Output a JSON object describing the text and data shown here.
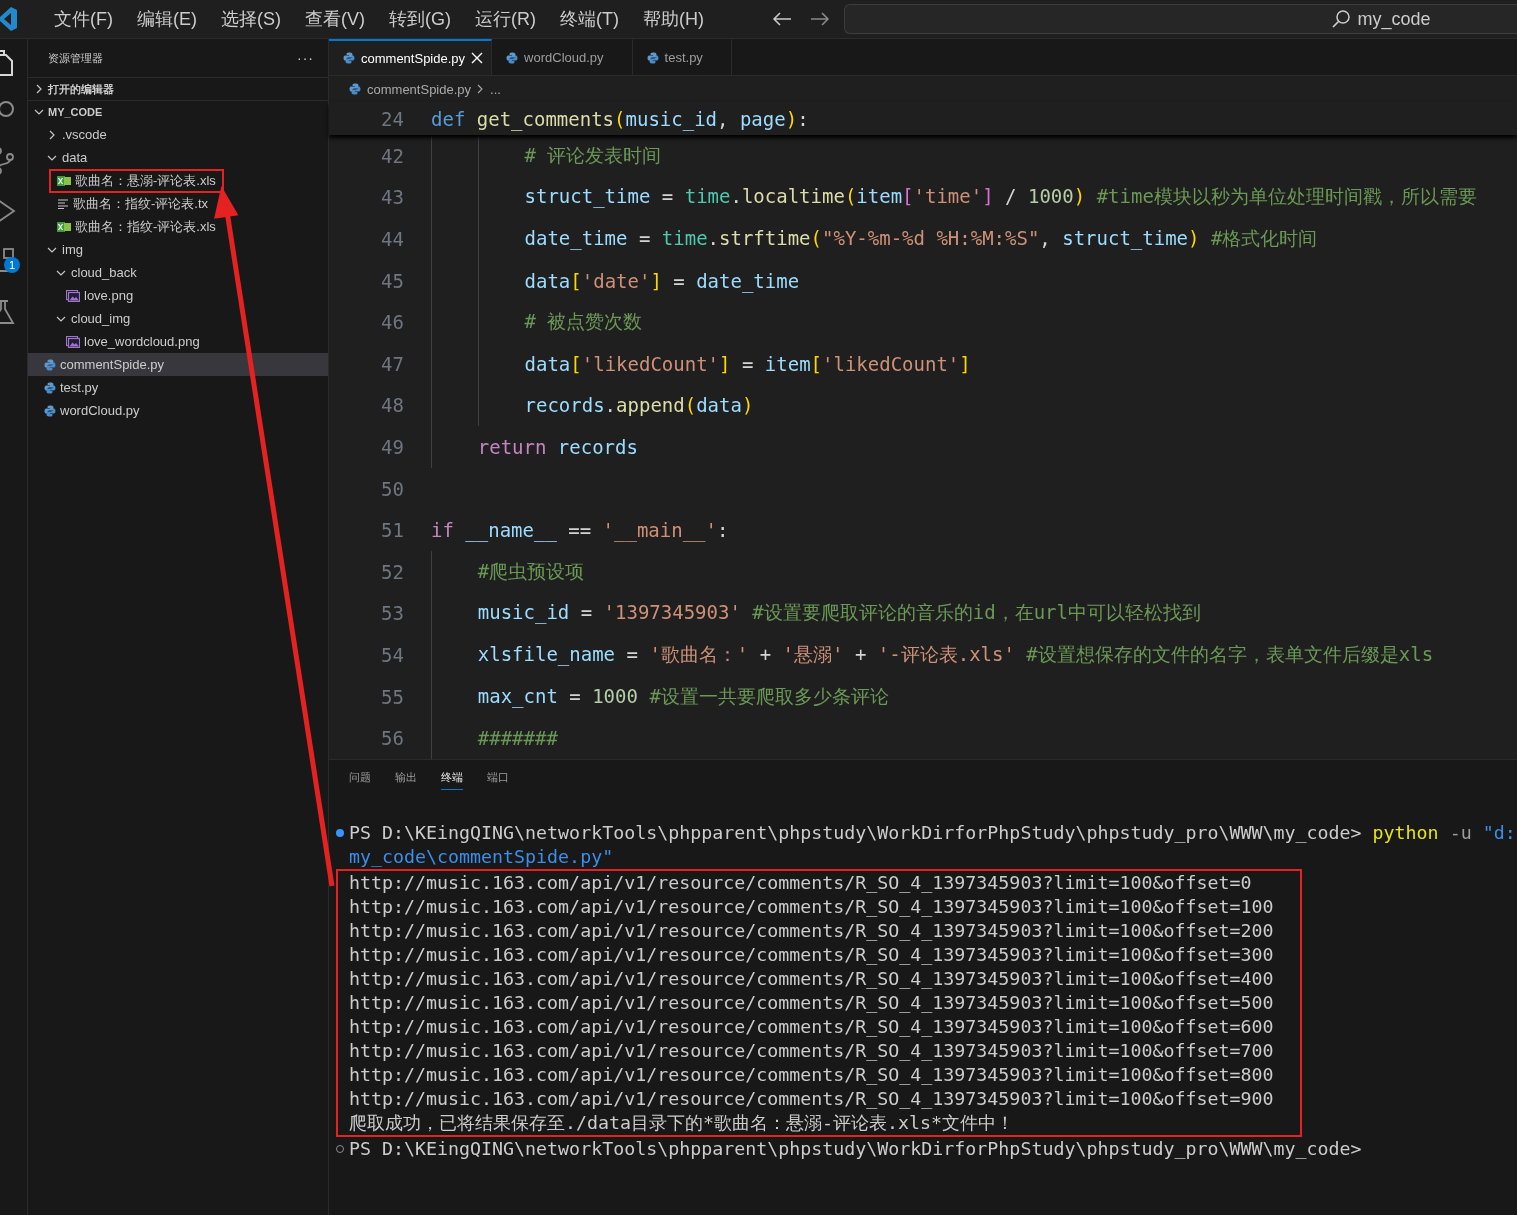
{
  "menu": [
    {
      "label": "文件(F)"
    },
    {
      "label": "编辑(E)"
    },
    {
      "label": "选择(S)"
    },
    {
      "label": "查看(V)"
    },
    {
      "label": "转到(G)"
    },
    {
      "label": "运行(R)"
    },
    {
      "label": "终端(T)"
    },
    {
      "label": "帮助(H)"
    }
  ],
  "search": {
    "value": "my_code"
  },
  "activity_bar": {
    "badge": "1"
  },
  "explorer": {
    "title": "资源管理器",
    "more": "···",
    "sections": [
      {
        "label": "打开的编辑器",
        "expanded": false
      },
      {
        "label": "MY_CODE",
        "expanded": true,
        "children": [
          {
            "label": ".vscode",
            "kind": "folder",
            "expanded": false,
            "selected": false,
            "highlighted": false
          },
          {
            "label": "data",
            "kind": "folder",
            "expanded": true,
            "selected": false,
            "highlighted": false,
            "children": [
              {
                "label": "歌曲名：悬溺-评论表.xls",
                "kind": "sheet",
                "selected": false,
                "highlighted": true
              },
              {
                "label": "歌曲名：指纹-评论表.tx",
                "kind": "text",
                "selected": false,
                "highlighted": false
              },
              {
                "label": "歌曲名：指纹-评论表.xls",
                "kind": "sheet",
                "selected": false,
                "highlighted": false
              }
            ]
          },
          {
            "label": "img",
            "kind": "folder",
            "expanded": true,
            "selected": false,
            "highlighted": false,
            "children": [
              {
                "label": "cloud_back",
                "kind": "folder",
                "expanded": true,
                "selected": false,
                "highlighted": false,
                "children": [
                  {
                    "label": "love.png",
                    "kind": "image",
                    "selected": false,
                    "highlighted": false
                  }
                ]
              },
              {
                "label": "cloud_img",
                "kind": "folder",
                "expanded": true,
                "selected": false,
                "highlighted": false,
                "children": [
                  {
                    "label": "love_wordcloud.png",
                    "kind": "image",
                    "selected": false,
                    "highlighted": false
                  }
                ]
              }
            ]
          },
          {
            "label": "commentSpide.py",
            "kind": "python",
            "selected": true,
            "highlighted": false
          },
          {
            "label": "test.py",
            "kind": "python",
            "selected": false,
            "highlighted": false
          },
          {
            "label": "wordCloud.py",
            "kind": "python",
            "selected": false,
            "highlighted": false
          }
        ]
      }
    ]
  },
  "tabs": [
    {
      "label": "commentSpide.py",
      "selected": true
    },
    {
      "label": "wordCloud.py",
      "selected": false
    },
    {
      "label": "test.py",
      "selected": false
    }
  ],
  "breadcrumb": {
    "file": "commentSpide.py",
    "rest": "..."
  },
  "sticky_line": {
    "number": "24",
    "kind": "top",
    "tokens": [
      {
        "kind": "kw",
        "text": "def "
      },
      {
        "kind": "fn",
        "text": "get_comments"
      },
      {
        "kind": "b1",
        "text": "("
      },
      {
        "kind": "var",
        "text": "music_id"
      },
      {
        "kind": "op",
        "text": ", "
      },
      {
        "kind": "var",
        "text": "page"
      },
      {
        "kind": "b1",
        "text": ")"
      },
      {
        "kind": "op",
        "text": ":"
      }
    ]
  },
  "code_lines": [
    {
      "number": "42",
      "kind": "inner",
      "tokens": [
        {
          "kind": "com",
          "text": "# 评论发表时间"
        }
      ]
    },
    {
      "number": "43",
      "kind": "inner",
      "tokens": [
        {
          "kind": "var",
          "text": "struct_time"
        },
        {
          "kind": "op",
          "text": " = "
        },
        {
          "kind": "mod",
          "text": "time"
        },
        {
          "kind": "op",
          "text": "."
        },
        {
          "kind": "fn",
          "text": "localtime"
        },
        {
          "kind": "b1",
          "text": "("
        },
        {
          "kind": "var",
          "text": "item"
        },
        {
          "kind": "b2",
          "text": "["
        },
        {
          "kind": "str",
          "text": "'time'"
        },
        {
          "kind": "b2",
          "text": "]"
        },
        {
          "kind": "op",
          "text": " / "
        },
        {
          "kind": "num",
          "text": "1000"
        },
        {
          "kind": "b1",
          "text": ") "
        },
        {
          "kind": "com",
          "text": "#time模块以秒为单位处理时间戳，所以需要"
        }
      ]
    },
    {
      "number": "44",
      "kind": "inner",
      "tokens": [
        {
          "kind": "var",
          "text": "date_time"
        },
        {
          "kind": "op",
          "text": " = "
        },
        {
          "kind": "mod",
          "text": "time"
        },
        {
          "kind": "op",
          "text": "."
        },
        {
          "kind": "fn",
          "text": "strftime"
        },
        {
          "kind": "b1",
          "text": "("
        },
        {
          "kind": "str",
          "text": "\"%Y-%m-%d %H:%M:%S\""
        },
        {
          "kind": "op",
          "text": ", "
        },
        {
          "kind": "var",
          "text": "struct_time"
        },
        {
          "kind": "b1",
          "text": ") "
        },
        {
          "kind": "com",
          "text": "#格式化时间"
        }
      ]
    },
    {
      "number": "45",
      "kind": "inner",
      "tokens": [
        {
          "kind": "var",
          "text": "data"
        },
        {
          "kind": "b1",
          "text": "["
        },
        {
          "kind": "str",
          "text": "'date'"
        },
        {
          "kind": "b1",
          "text": "]"
        },
        {
          "kind": "op",
          "text": " = "
        },
        {
          "kind": "var",
          "text": "date_time"
        }
      ]
    },
    {
      "number": "46",
      "kind": "inner",
      "tokens": [
        {
          "kind": "com",
          "text": "# 被点赞次数"
        }
      ]
    },
    {
      "number": "47",
      "kind": "inner",
      "tokens": [
        {
          "kind": "var",
          "text": "data"
        },
        {
          "kind": "b1",
          "text": "["
        },
        {
          "kind": "str",
          "text": "'likedCount'"
        },
        {
          "kind": "b1",
          "text": "]"
        },
        {
          "kind": "op",
          "text": " = "
        },
        {
          "kind": "var",
          "text": "item"
        },
        {
          "kind": "b1",
          "text": "["
        },
        {
          "kind": "str",
          "text": "'likedCount'"
        },
        {
          "kind": "b1",
          "text": "]"
        }
      ]
    },
    {
      "number": "48",
      "kind": "inner",
      "tokens": [
        {
          "kind": "var",
          "text": "records"
        },
        {
          "kind": "op",
          "text": "."
        },
        {
          "kind": "fn",
          "text": "append"
        },
        {
          "kind": "b1",
          "text": "("
        },
        {
          "kind": "var",
          "text": "data"
        },
        {
          "kind": "b1",
          "text": ")"
        }
      ]
    },
    {
      "number": "49",
      "kind": "outer",
      "tokens": [
        {
          "kind": "ctl",
          "text": "return "
        },
        {
          "kind": "var",
          "text": "records"
        }
      ]
    },
    {
      "number": "50",
      "kind": "top"
    },
    {
      "number": "51",
      "kind": "top",
      "tokens": [
        {
          "kind": "ctl",
          "text": "if "
        },
        {
          "kind": "var",
          "text": "__name__"
        },
        {
          "kind": "op",
          "text": " == "
        },
        {
          "kind": "str",
          "text": "'__main__'"
        },
        {
          "kind": "op",
          "text": ":"
        }
      ]
    },
    {
      "number": "52",
      "kind": "outer",
      "tokens": [
        {
          "kind": "com",
          "text": "#爬虫预设项"
        }
      ]
    },
    {
      "number": "53",
      "kind": "outer",
      "tokens": [
        {
          "kind": "var",
          "text": "music_id"
        },
        {
          "kind": "op",
          "text": " = "
        },
        {
          "kind": "str",
          "text": "'1397345903' "
        },
        {
          "kind": "com",
          "text": "#设置要爬取评论的音乐的id，在url中可以轻松找到"
        }
      ]
    },
    {
      "number": "54",
      "kind": "outer",
      "tokens": [
        {
          "kind": "var",
          "text": "xlsfile_name"
        },
        {
          "kind": "op",
          "text": " = "
        },
        {
          "kind": "str",
          "text": "'歌曲名：'"
        },
        {
          "kind": "op",
          "text": " + "
        },
        {
          "kind": "str",
          "text": "'悬溺'"
        },
        {
          "kind": "op",
          "text": " + "
        },
        {
          "kind": "str",
          "text": "'-评论表.xls' "
        },
        {
          "kind": "com",
          "text": "#设置想保存的文件的名字，表单文件后缀是xls"
        }
      ]
    },
    {
      "number": "55",
      "kind": "outer",
      "tokens": [
        {
          "kind": "var",
          "text": "max_cnt"
        },
        {
          "kind": "op",
          "text": " = "
        },
        {
          "kind": "num",
          "text": "1000 "
        },
        {
          "kind": "com",
          "text": "#设置一共要爬取多少条评论"
        }
      ]
    },
    {
      "number": "56",
      "kind": "outer",
      "tokens": [
        {
          "kind": "com",
          "text": "#######"
        }
      ]
    }
  ],
  "panel_tabs": [
    {
      "label": "问题",
      "selected": false
    },
    {
      "label": "输出",
      "selected": false
    },
    {
      "label": "终端",
      "selected": true
    },
    {
      "label": "端口",
      "selected": false
    }
  ],
  "terminal": [
    {
      "kind": "prompt",
      "succeeded": true,
      "tokens": [
        {
          "kind": "plain",
          "text": "PS D:\\KEingQING\\networkTools\\phpparent\\phpstudy\\WorkDirforPhpStudy\\phpstudy_pro\\WWW\\my_code>"
        },
        {
          "kind": "command",
          "text": "python"
        },
        {
          "kind": "flag",
          "text": "-u"
        },
        {
          "kind": "string",
          "text": "\"d:"
        }
      ]
    },
    {
      "kind": "continuation",
      "tokens": [
        {
          "kind": "string",
          "text": "my_code\\commentSpide.py\""
        }
      ]
    },
    {
      "kind": "output",
      "highlighted": true,
      "lines": [
        "http://music.163.com/api/v1/resource/comments/R_SO_4_1397345903?limit=100&offset=0",
        "http://music.163.com/api/v1/resource/comments/R_SO_4_1397345903?limit=100&offset=100",
        "http://music.163.com/api/v1/resource/comments/R_SO_4_1397345903?limit=100&offset=200",
        "http://music.163.com/api/v1/resource/comments/R_SO_4_1397345903?limit=100&offset=300",
        "http://music.163.com/api/v1/resource/comments/R_SO_4_1397345903?limit=100&offset=400",
        "http://music.163.com/api/v1/resource/comments/R_SO_4_1397345903?limit=100&offset=500",
        "http://music.163.com/api/v1/resource/comments/R_SO_4_1397345903?limit=100&offset=600",
        "http://music.163.com/api/v1/resource/comments/R_SO_4_1397345903?limit=100&offset=700",
        "http://music.163.com/api/v1/resource/comments/R_SO_4_1397345903?limit=100&offset=800",
        "http://music.163.com/api/v1/resource/comments/R_SO_4_1397345903?limit=100&offset=900",
        "爬取成功，已将结果保存至./data目录下的*歌曲名：悬溺-评论表.xls*文件中！"
      ]
    },
    {
      "kind": "prompt",
      "succeeded": false,
      "tokens": [
        {
          "kind": "plain",
          "text": "PS D:\\KEingQING\\networkTools\\phpparent\\phpstudy\\WorkDirforPhpStudy\\phpstudy_pro\\WWW\\my_code>"
        }
      ]
    }
  ]
}
